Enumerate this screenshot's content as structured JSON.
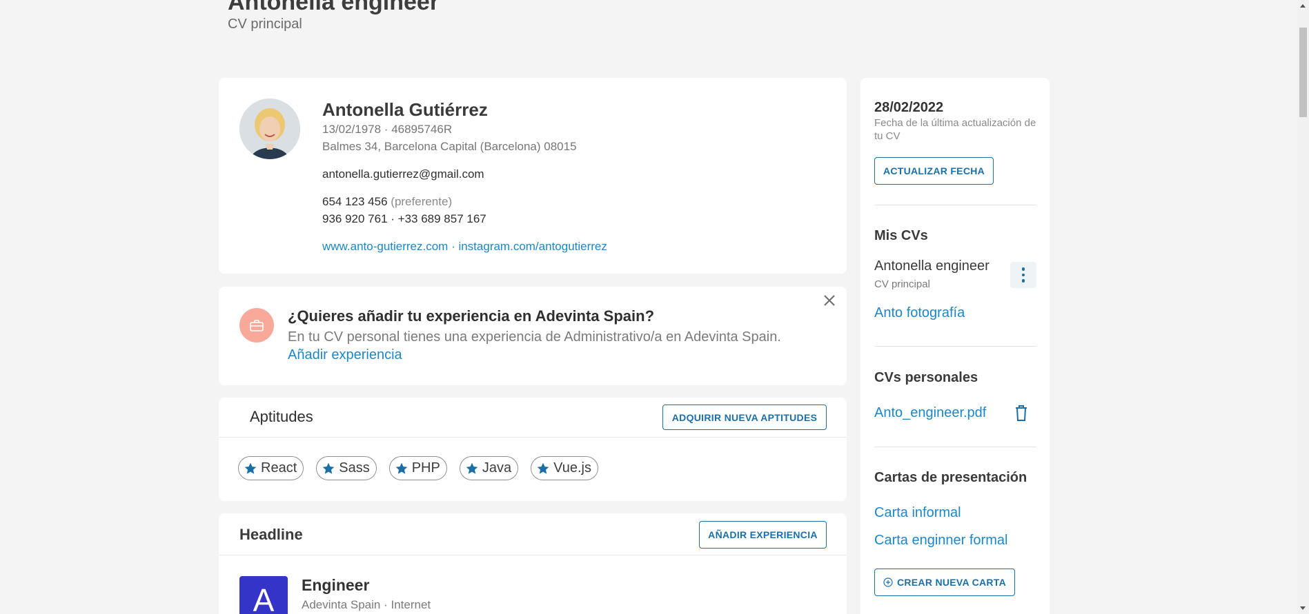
{
  "page": {
    "title": "Antonella engineer",
    "subtitle": "CV principal"
  },
  "profile": {
    "avatar_icon": "person-photo-avatar",
    "name": "Antonella Gutiérrez",
    "birth_id": "13/02/1978 · 46895746R",
    "address": "Balmes 34, Barcelona Capital (Barcelona) 08015",
    "email": "antonella.gutierrez@gmail.com",
    "phone_preferred": "654 123 456",
    "phone_preferred_note": "(preferente)",
    "phones_other": "936 920 761 · +33 689 857 167",
    "website": "www.anto-gutierrez.com",
    "link_separator": " · ",
    "instagram": "instagram.com/antogutierrez"
  },
  "suggestion": {
    "icon": "briefcase-icon",
    "title": "¿Quieres añadir tu experiencia en Adevinta Spain?",
    "text": "En tu CV personal tienes una experiencia de Administrativo/a en Adevinta Spain.",
    "link": "Añadir experiencia",
    "close_icon": "close-icon"
  },
  "skills": {
    "title": "Aptitudes",
    "button": "ADQUIRIR NUEVA APTITUDES",
    "items": [
      "React",
      "Sass",
      "PHP",
      "Java",
      "Vue.js"
    ],
    "chip_icon": "star-icon"
  },
  "headline": {
    "title": "Headline",
    "button": "AÑADIR EXPERIENCIA",
    "job_title": "Engineer",
    "job_sub": "Adevinta Spain · Internet",
    "logo_letter": "A"
  },
  "sidebar": {
    "date": "28/02/2022",
    "date_note": "Fecha de la última actualización de tu CV",
    "update_button": "ACTUALIZAR FECHA",
    "my_cvs_title": "Mis CVs",
    "cv_name": "Antonella engineer",
    "cv_tag": "CV principal",
    "cv_other": "Anto fotografía",
    "personal_title": "CVs personales",
    "personal_file": "Anto_engineer.pdf",
    "letters_title": "Cartas de presentación",
    "letter_1": "Carta informal",
    "letter_2": "Carta enginner formal",
    "new_letter_button": "CREAR NUEVA CARTA"
  },
  "colors": {
    "accent": "#1b87c9",
    "button_border": "#1b6fa8",
    "suggestion_icon_bg": "#f8a99a",
    "company_logo_bg": "#3434c8",
    "page_bg": "#f4f4f4"
  }
}
